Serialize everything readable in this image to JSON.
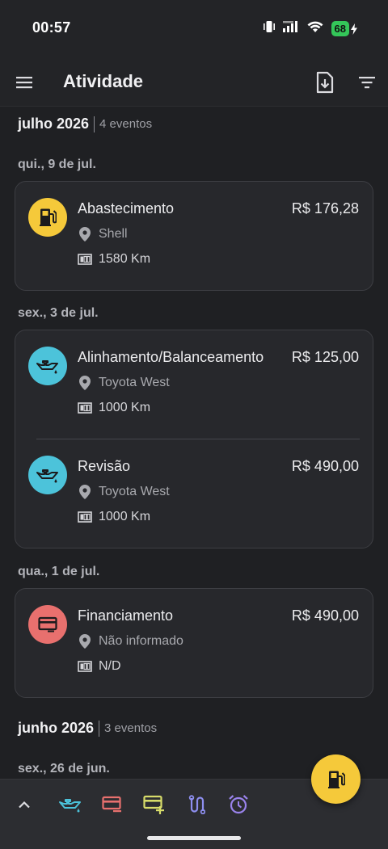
{
  "status_bar": {
    "time": "00:57",
    "battery": "68"
  },
  "app_bar": {
    "title": "Atividade"
  },
  "months": [
    {
      "title": "julho 2026",
      "count": "4 eventos"
    },
    {
      "title": "junho 2026",
      "count": "3 eventos"
    }
  ],
  "days": [
    {
      "label": "qui., 9 de jul."
    },
    {
      "label": "sex., 3 de jul."
    },
    {
      "label": "qua., 1 de jul."
    },
    {
      "label": "sex., 26 de jun."
    }
  ],
  "events": [
    {
      "title": "Abastecimento",
      "amount": "R$ 176,28",
      "place": "Shell",
      "odometer": "1580 Km",
      "icon": "fuel-pump-icon"
    },
    {
      "title": "Alinhamento/Balanceamento",
      "amount": "R$ 125,00",
      "place": "Toyota West",
      "odometer": "1000 Km",
      "icon": "oil-can-icon"
    },
    {
      "title": "Revisão",
      "amount": "R$ 490,00",
      "place": "Toyota West",
      "odometer": "1000 Km",
      "icon": "oil-can-icon"
    },
    {
      "title": "Financiamento",
      "amount": "R$ 490,00",
      "place": "Não informado",
      "odometer": "N/D",
      "icon": "credit-card-icon"
    }
  ],
  "colors": {
    "fuel": "#f5c93a",
    "service": "#4cc3da",
    "expense": "#e8706e",
    "income": "#d7dc6a",
    "route": "#8e8ff0",
    "reminder": "#9a83ec"
  },
  "bottom_bar": {
    "buttons": [
      "chevron-up-icon",
      "oil-can-icon",
      "credit-card-minus-icon",
      "credit-card-plus-icon",
      "route-icon",
      "alarm-clock-icon"
    ]
  }
}
